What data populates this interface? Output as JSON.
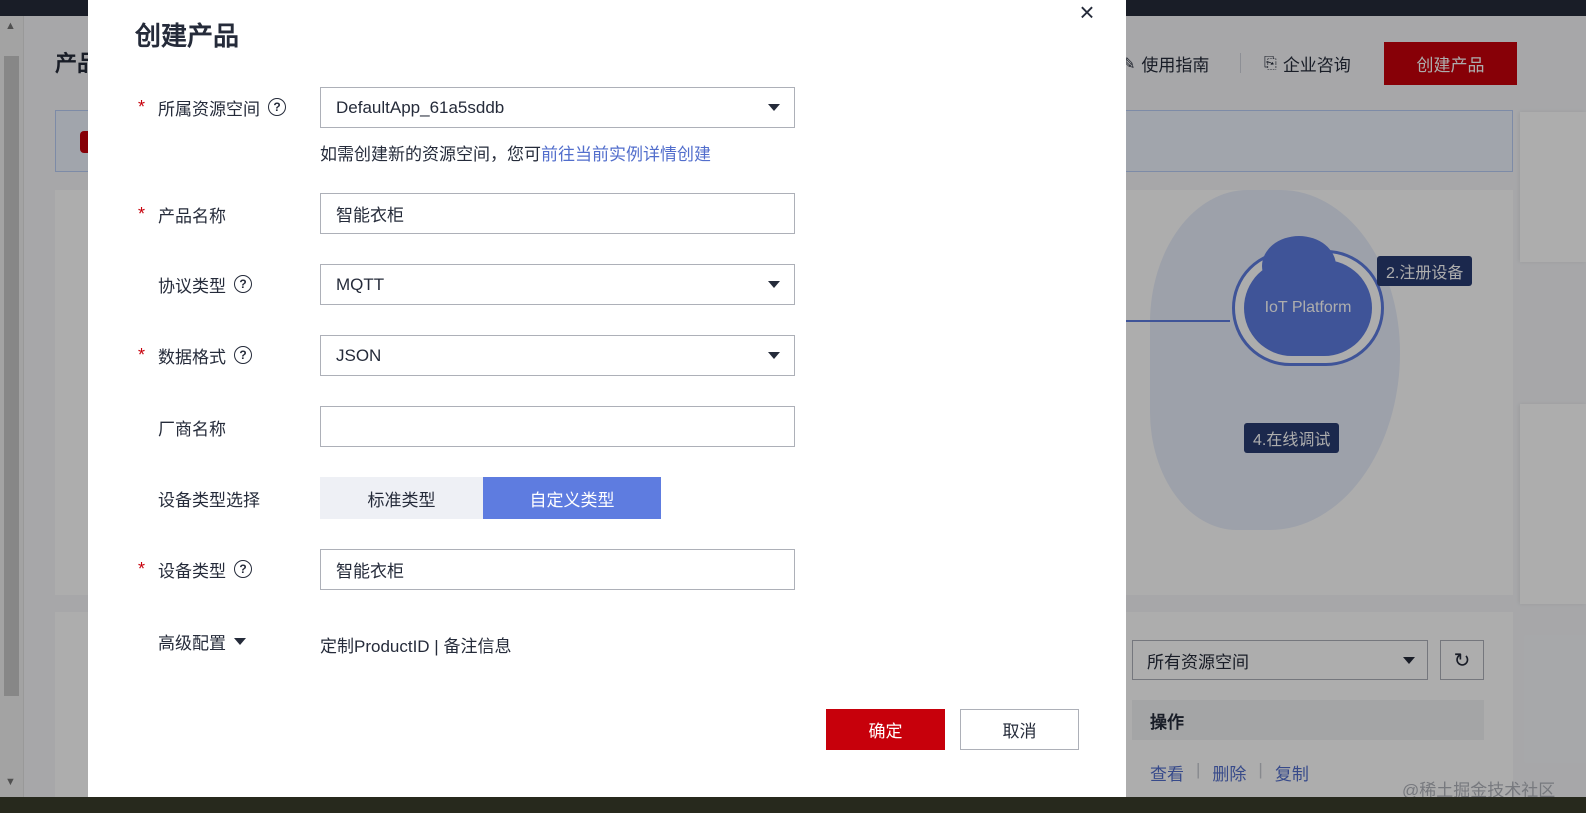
{
  "background": {
    "page_title": "产品",
    "header_links": [
      {
        "label": "使用指南",
        "icon": "guide-icon"
      },
      {
        "label": "企业咨询",
        "icon": "consult-icon"
      }
    ],
    "create_button_label": "创建产品",
    "diagram": {
      "platform_label": "IoT Platform",
      "step2": "2.注册设备",
      "step4": "4.在线调试"
    },
    "resource_space_select": "所有资源空间",
    "table_header_ops": "操作",
    "row_actions": [
      "查看",
      "删除",
      "复制"
    ],
    "watermark": "@稀土掘金技术社区"
  },
  "modal": {
    "title": "创建产品",
    "close_icon": "×",
    "resource_space": {
      "label": "所属资源空间",
      "value": "DefaultApp_61a5sddb",
      "hint_prefix": "如需创建新的资源空间，您可",
      "hint_link": "前往当前实例详情创建"
    },
    "product_name": {
      "label": "产品名称",
      "value": "智能衣柜"
    },
    "protocol": {
      "label": "协议类型",
      "value": "MQTT"
    },
    "data_format": {
      "label": "数据格式",
      "value": "JSON"
    },
    "vendor": {
      "label": "厂商名称",
      "value": ""
    },
    "device_type_select": {
      "label": "设备类型选择",
      "options": [
        "标准类型",
        "自定义类型"
      ],
      "selected": "自定义类型"
    },
    "device_type": {
      "label": "设备类型",
      "value": "智能衣柜"
    },
    "advanced": {
      "label": "高级配置",
      "summary": "定制ProductID | 备注信息"
    },
    "required_mark": "*",
    "help_mark": "?",
    "ok_label": "确定",
    "cancel_label": "取消"
  },
  "colors": {
    "brand_red": "#c7000b",
    "accent_blue": "#5e7ce0",
    "link_blue": "#526ecc"
  }
}
